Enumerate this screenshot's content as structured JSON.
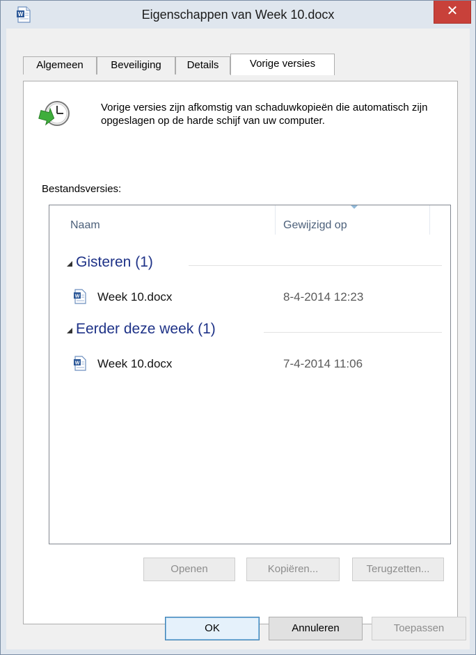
{
  "window": {
    "title": "Eigenschappen van Week 10.docx",
    "close_glyph": "✕",
    "icon": "word-document-icon"
  },
  "tabs": [
    {
      "label": "Algemeen",
      "active": false
    },
    {
      "label": "Beveiliging",
      "active": false
    },
    {
      "label": "Details",
      "active": false
    },
    {
      "label": "Vorige versies",
      "active": true
    }
  ],
  "info": {
    "icon": "restore-clock-icon",
    "text": "Vorige versies zijn afkomstig van schaduwkopieën die automatisch zijn opgeslagen op de harde schijf van uw computer."
  },
  "versions": {
    "label": "Bestandsversies:",
    "columns": {
      "name": "Naam",
      "modified": "Gewijzigd op"
    },
    "groups": [
      {
        "title": "Gisteren (1)",
        "items": [
          {
            "name": "Week 10.docx",
            "modified": "8-4-2014 12:23"
          }
        ]
      },
      {
        "title": "Eerder deze week (1)",
        "items": [
          {
            "name": "Week 10.docx",
            "modified": "7-4-2014 11:06"
          }
        ]
      }
    ]
  },
  "actions": {
    "open": "Openen",
    "copy": "Kopiëren...",
    "restore": "Terugzetten..."
  },
  "footer": {
    "ok": "OK",
    "cancel": "Annuleren",
    "apply": "Toepassen"
  },
  "colors": {
    "group_heading": "#1e3287",
    "close_button": "#c8413a",
    "window_frame": "#dfe6ee"
  }
}
